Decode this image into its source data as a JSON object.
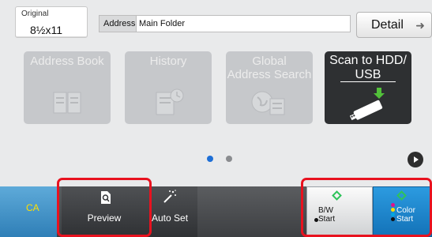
{
  "header": {
    "original_label": "Original",
    "original_size": "8½x11",
    "address_label": "Address",
    "address_value": "Main Folder",
    "detail_label": "Detail"
  },
  "tiles": [
    {
      "label": "Address Book",
      "state": "disabled",
      "icon": "address-book-icon"
    },
    {
      "label": "History",
      "state": "disabled",
      "icon": "history-icon"
    },
    {
      "label": "Global\nAddress Search",
      "state": "disabled",
      "icon": "global-address-search-icon"
    },
    {
      "label": "Scan to HDD/\nUSB",
      "state": "enabled",
      "icon": "usb-drive-icon"
    }
  ],
  "pagination": {
    "pages": 2,
    "current": 1
  },
  "bottom_bar": {
    "ca_label": "CA",
    "preview_label": "Preview",
    "autoset_label": "Auto Set",
    "bw_start_line1": "B/W",
    "bw_start_line2": "Start",
    "color_start_line1": "Color",
    "color_start_line2": "Start"
  },
  "colors": {
    "ca_text": "#ffe000",
    "color_start": "#1e86cc",
    "highlight": "#e8121f",
    "active_page_dot": "#1e6fd6"
  }
}
